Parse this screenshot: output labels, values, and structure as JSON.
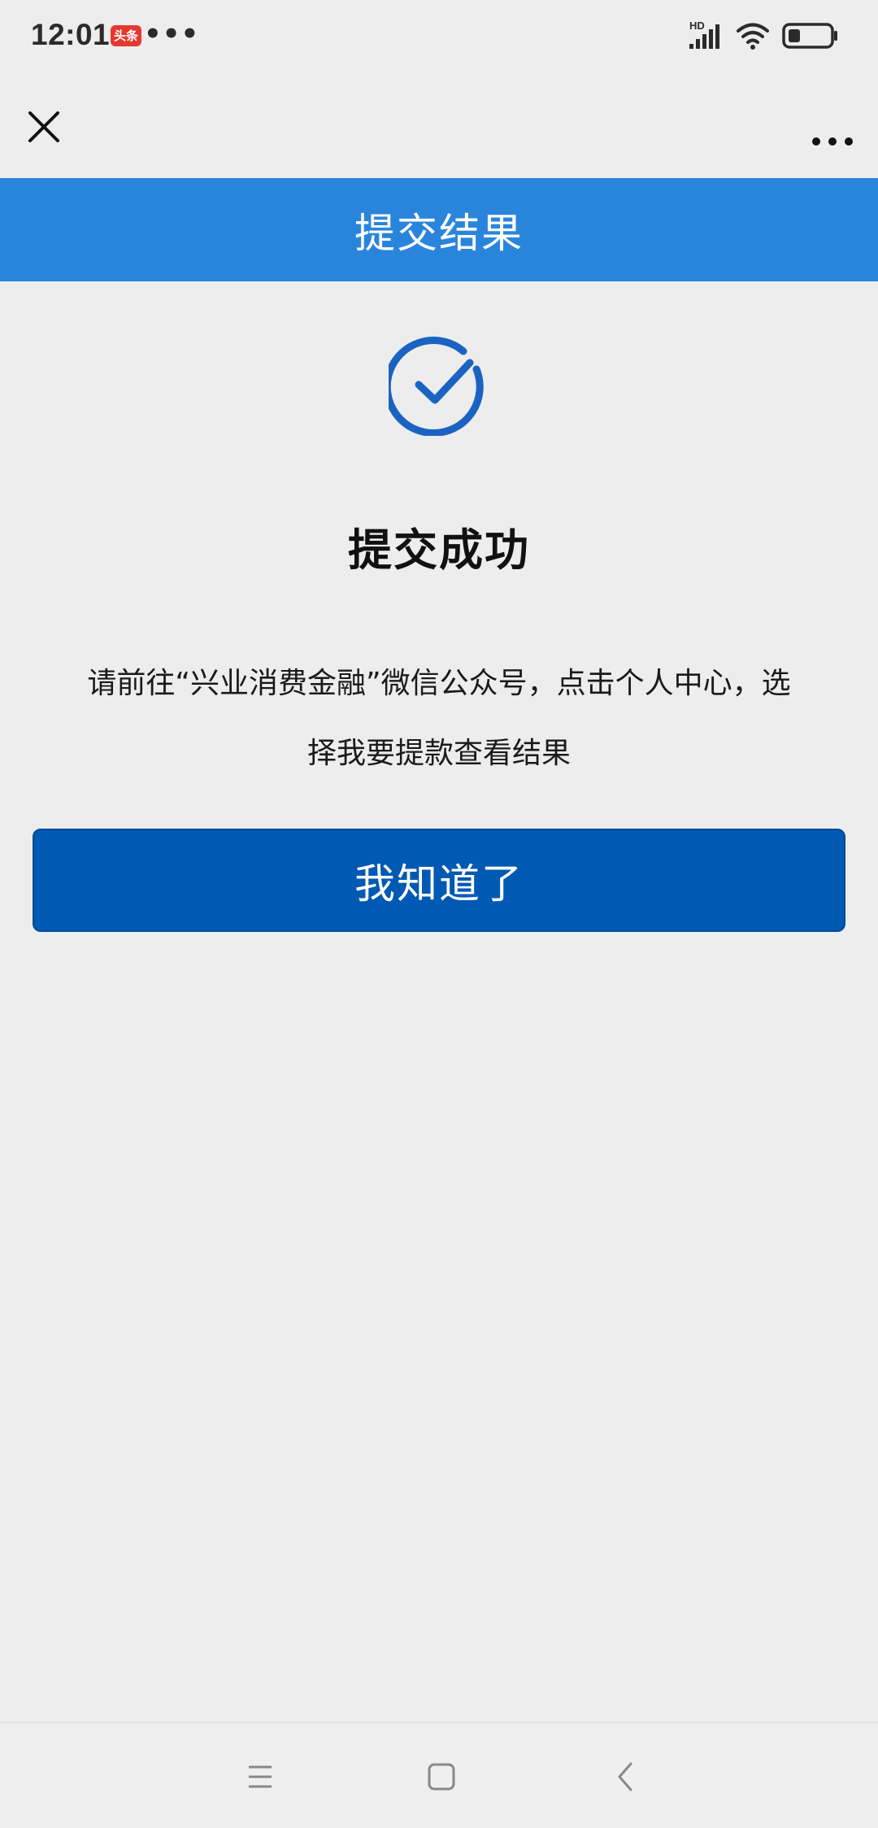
{
  "status_bar": {
    "time": "12:01",
    "app_badge": "头条",
    "more_notifications": "•••",
    "network_label": "HD"
  },
  "nav": {
    "close_icon": "close-icon",
    "more_icon": "more-icon"
  },
  "header": {
    "title": "提交结果"
  },
  "result": {
    "icon": "check-circle-icon",
    "title": "提交成功",
    "message_line1": "请前往“兴业消费金融”微信公众号，点击个人中心，选",
    "message_line2": "择我要提款查看结果"
  },
  "actions": {
    "confirm_label": "我知道了"
  },
  "system_nav": {
    "menu_icon": "menu-icon",
    "home_icon": "home-icon",
    "back_icon": "back-icon"
  },
  "colors": {
    "header_bg": "#2985dc",
    "button_bg": "#0059b3",
    "icon_blue": "#1a63c2",
    "page_bg": "#ededed"
  }
}
